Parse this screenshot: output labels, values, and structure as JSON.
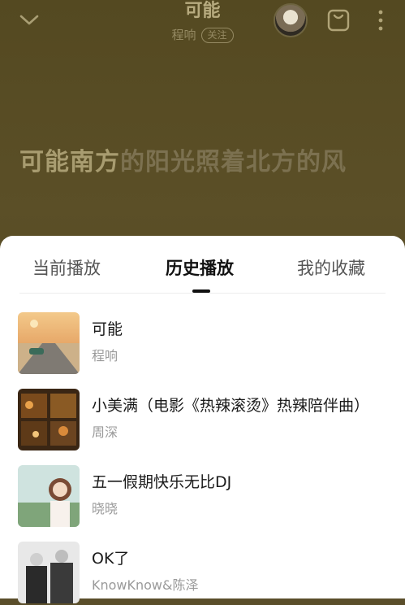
{
  "player": {
    "song_title": "可能",
    "artist": "程响",
    "follow_label": "关注",
    "lyric_highlight": "可能南方",
    "lyric_rest": "的阳光照着北方的风"
  },
  "sheet": {
    "tabs": [
      {
        "label": "当前播放"
      },
      {
        "label": "历史播放"
      },
      {
        "label": "我的收藏"
      }
    ],
    "active_tab": "历史播放",
    "tracks": [
      {
        "title": "可能",
        "artist": "程响"
      },
      {
        "title": "小美满（电影《热辣滚烫》热辣陪伴曲）",
        "artist": "周深"
      },
      {
        "title": "五一假期快乐无比DJ",
        "artist": "晓晓"
      },
      {
        "title": "OK了",
        "artist": "KnowKnow&陈泽"
      }
    ]
  },
  "icons": [
    "chevron-down-icon",
    "avatar",
    "playlist-icon",
    "more-vertical-icon"
  ],
  "colors": {
    "background": "#544921",
    "sheet": "#ffffff",
    "accent_text": "#111111"
  }
}
